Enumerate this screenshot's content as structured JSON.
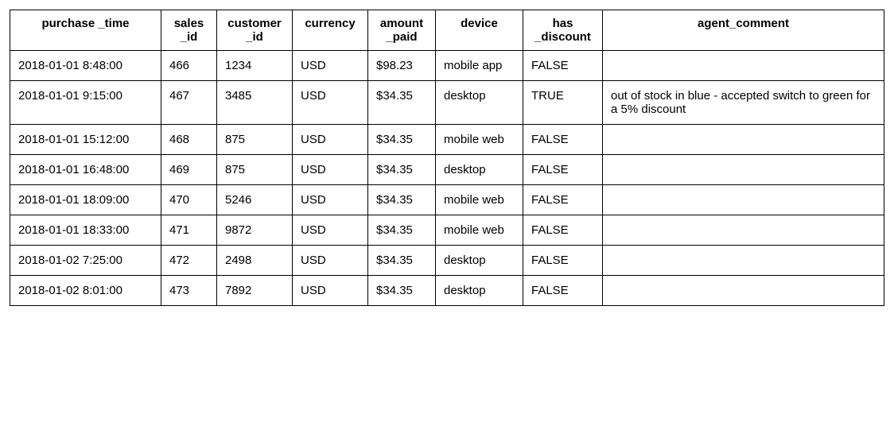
{
  "table": {
    "headers": [
      "purchase _time",
      "sales _id",
      "customer _id",
      "currency",
      "amount _paid",
      "device",
      "has _discount",
      "agent_comment"
    ],
    "rows": [
      {
        "purchase_time": "2018-01-01 8:48:00",
        "sales_id": "466",
        "customer_id": "1234",
        "currency": "USD",
        "amount_paid": "$98.23",
        "device": "mobile app",
        "has_discount": "FALSE",
        "agent_comment": ""
      },
      {
        "purchase_time": "2018-01-01 9:15:00",
        "sales_id": "467",
        "customer_id": "3485",
        "currency": "USD",
        "amount_paid": "$34.35",
        "device": "desktop",
        "has_discount": "TRUE",
        "agent_comment": "out of stock in blue - accepted switch to green for a 5% discount"
      },
      {
        "purchase_time": "2018-01-01 15:12:00",
        "sales_id": "468",
        "customer_id": "875",
        "currency": "USD",
        "amount_paid": "$34.35",
        "device": "mobile web",
        "has_discount": "FALSE",
        "agent_comment": ""
      },
      {
        "purchase_time": "2018-01-01 16:48:00",
        "sales_id": "469",
        "customer_id": "875",
        "currency": "USD",
        "amount_paid": "$34.35",
        "device": "desktop",
        "has_discount": "FALSE",
        "agent_comment": ""
      },
      {
        "purchase_time": "2018-01-01 18:09:00",
        "sales_id": "470",
        "customer_id": "5246",
        "currency": "USD",
        "amount_paid": "$34.35",
        "device": "mobile web",
        "has_discount": "FALSE",
        "agent_comment": ""
      },
      {
        "purchase_time": "2018-01-01 18:33:00",
        "sales_id": "471",
        "customer_id": "9872",
        "currency": "USD",
        "amount_paid": "$34.35",
        "device": "mobile web",
        "has_discount": "FALSE",
        "agent_comment": ""
      },
      {
        "purchase_time": "2018-01-02 7:25:00",
        "sales_id": "472",
        "customer_id": "2498",
        "currency": "USD",
        "amount_paid": "$34.35",
        "device": "desktop",
        "has_discount": "FALSE",
        "agent_comment": ""
      },
      {
        "purchase_time": "2018-01-02 8:01:00",
        "sales_id": "473",
        "customer_id": "7892",
        "currency": "USD",
        "amount_paid": "$34.35",
        "device": "desktop",
        "has_discount": "FALSE",
        "agent_comment": ""
      }
    ]
  }
}
